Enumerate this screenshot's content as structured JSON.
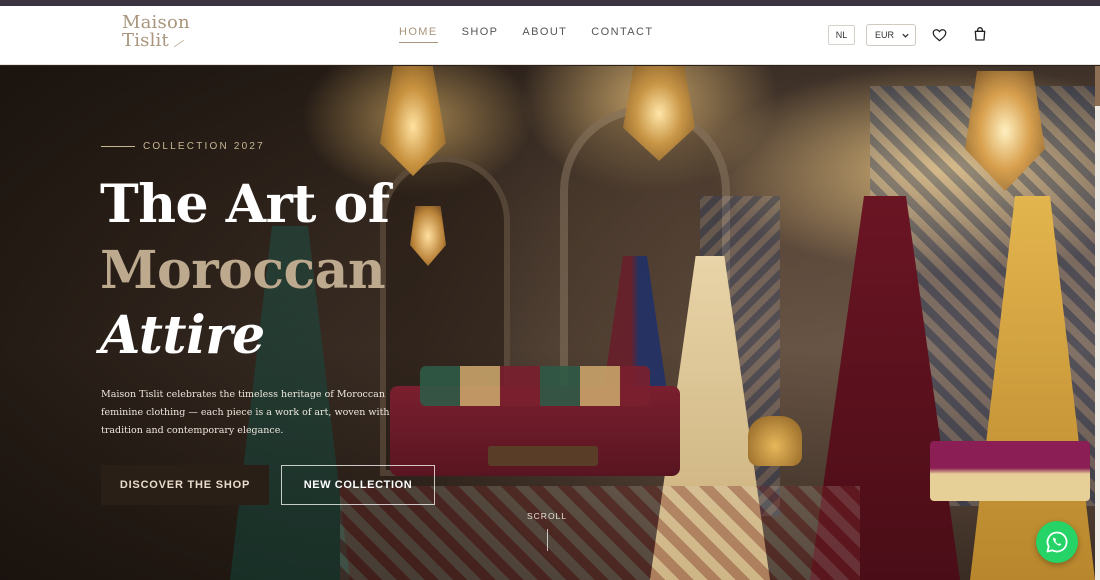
{
  "header": {
    "logo_line1": "Maison",
    "logo_line2": "Tislit",
    "nav": [
      {
        "label": "HOME",
        "active": true
      },
      {
        "label": "SHOP",
        "active": false
      },
      {
        "label": "ABOUT",
        "active": false
      },
      {
        "label": "CONTACT",
        "active": false
      }
    ],
    "language": "NL",
    "currency": "EUR",
    "icons": [
      "heart-icon",
      "bag-icon",
      "chevron-down-icon"
    ]
  },
  "hero": {
    "eyebrow": "COLLECTION 2027",
    "title_line1": "The Art of",
    "title_line2": "Moroccan",
    "title_line3": "Attire",
    "description": "Maison Tislit celebrates the timeless heritage of Moroccan feminine clothing — each piece is a work of art, woven with tradition and contemporary elegance.",
    "primary_button": "DISCOVER THE SHOP",
    "secondary_button": "NEW COLLECTION",
    "scroll_label": "SCROLL"
  },
  "floating": {
    "whatsapp_icon": "whatsapp-icon"
  },
  "colors": {
    "accent": "#a8957c",
    "title_accent": "#bca98e",
    "whatsapp": "#25d366",
    "dark_button": "#2a1f17"
  }
}
